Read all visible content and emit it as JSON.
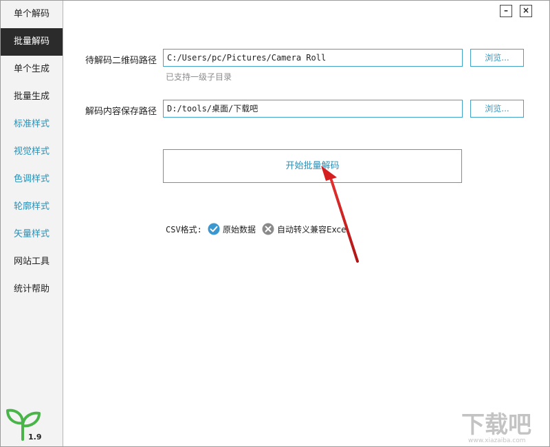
{
  "sidebar": {
    "items": [
      {
        "label": "单个解码"
      },
      {
        "label": "批量解码"
      },
      {
        "label": "单个生成"
      },
      {
        "label": "批量生成"
      },
      {
        "label": "标准样式"
      },
      {
        "label": "视觉样式"
      },
      {
        "label": "色调样式"
      },
      {
        "label": "轮廓样式"
      },
      {
        "label": "矢量样式"
      },
      {
        "label": "网站工具"
      },
      {
        "label": "统计帮助"
      }
    ],
    "active_index": 1,
    "version": "1.9",
    "logo_icon": "sprout-icon",
    "accent_color": "#2a8fb5",
    "logo_color": "#4ab44a"
  },
  "window_controls": {
    "minimize": "–",
    "close": "×"
  },
  "form": {
    "source_label": "待解码二维码路径",
    "source_value": "C:/Users/pc/Pictures/Camera Roll",
    "source_hint": "已支持一级子目录",
    "output_label": "解码内容保存路径",
    "output_value": "D:/tools/桌面/下载吧",
    "browse_label": "浏览...",
    "start_button": "开始批量解码"
  },
  "csv": {
    "label": "CSV格式:",
    "options": [
      {
        "label": "原始数据",
        "checked": true,
        "icon": "check-circle-icon",
        "color": "#3a97cf"
      },
      {
        "label": "自动转义兼容Excel",
        "checked": false,
        "icon": "x-circle-icon",
        "color": "#8a8a8a"
      }
    ]
  },
  "annotation": {
    "arrow_color": "#d42020"
  },
  "watermark": {
    "text": "下载吧",
    "url": "www.xiazaiba.com"
  }
}
